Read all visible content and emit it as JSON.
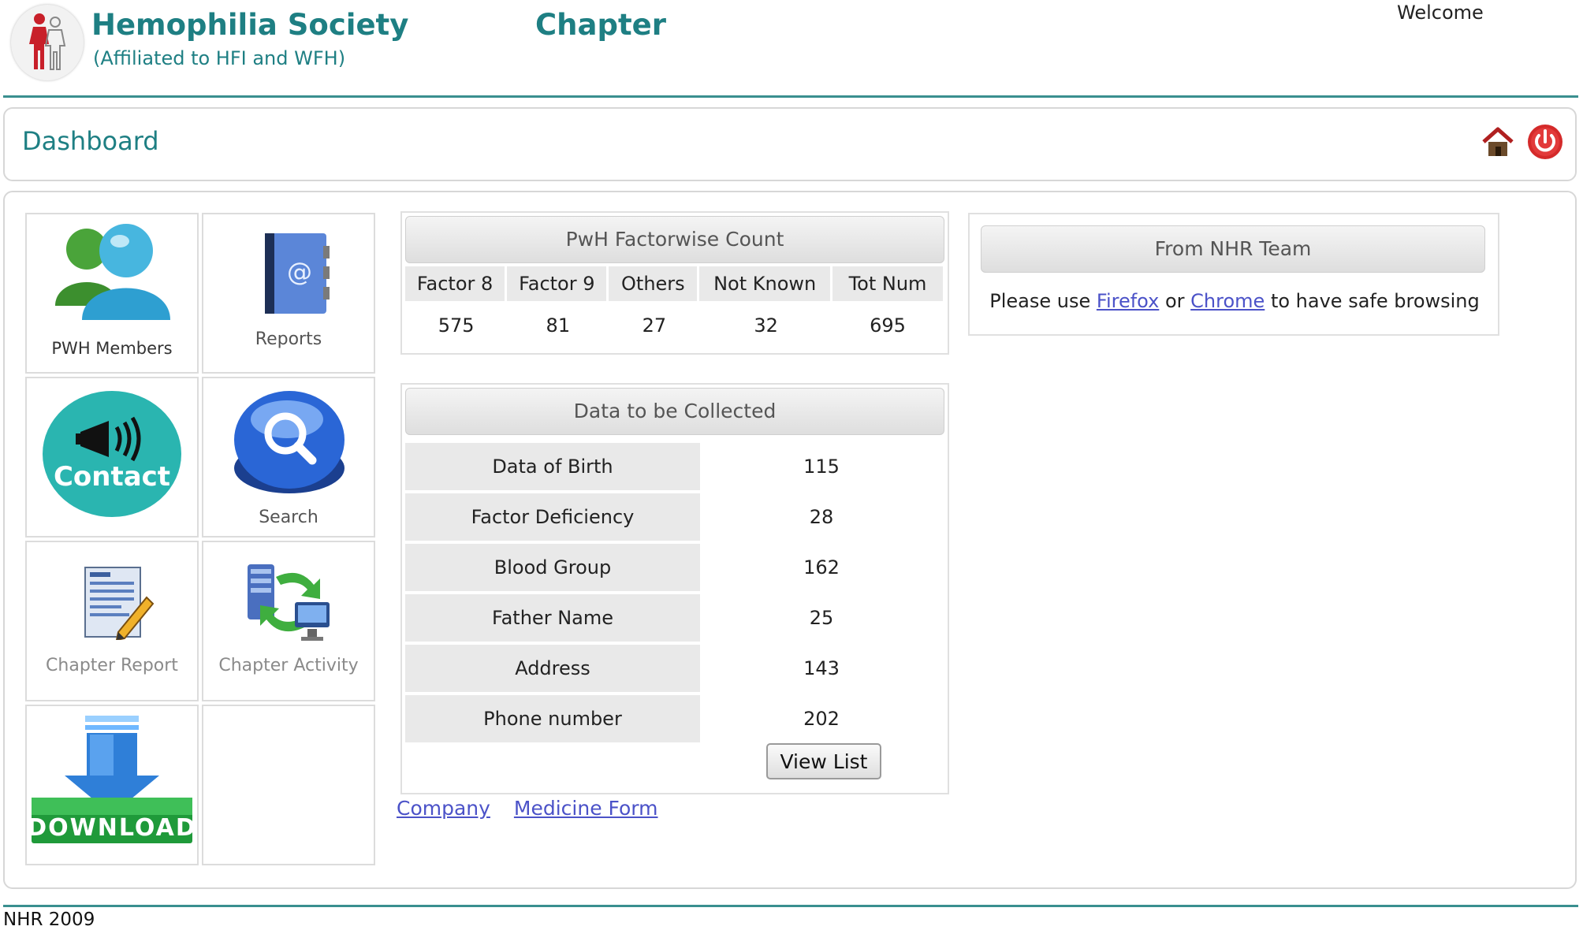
{
  "header": {
    "org_name": "Hemophilia Society",
    "org_subtitle": "(Affiliated to HFI and WFH)",
    "chapter_title": "Chapter",
    "welcome": "Welcome"
  },
  "dashbar": {
    "title": "Dashboard",
    "home_icon": "home-icon",
    "power_icon": "power-icon"
  },
  "tiles": [
    {
      "label": "PWH Members",
      "icon": "members-icon"
    },
    {
      "label": "Reports",
      "icon": "address-book-icon"
    },
    {
      "label": "Contact",
      "icon": "megaphone-icon"
    },
    {
      "label": "Search",
      "icon": "search-icon"
    },
    {
      "label": "Chapter Report",
      "icon": "report-document-icon"
    },
    {
      "label": "Chapter Activity",
      "icon": "activity-sync-icon"
    },
    {
      "label": "DOWNLOAD",
      "icon": "download-arrow-icon"
    }
  ],
  "factorwise": {
    "title": "PwH Factorwise Count",
    "headers": [
      "Factor 8",
      "Factor 9",
      "Others",
      "Not Known",
      "Tot Num"
    ],
    "values": [
      "575",
      "81",
      "27",
      "32",
      "695"
    ]
  },
  "data_collected": {
    "title": "Data to be Collected",
    "rows": [
      {
        "label": "Data of Birth",
        "value": "115"
      },
      {
        "label": "Factor Deficiency",
        "value": "28"
      },
      {
        "label": "Blood Group",
        "value": "162"
      },
      {
        "label": "Father Name",
        "value": "25"
      },
      {
        "label": "Address",
        "value": "143"
      },
      {
        "label": "Phone number",
        "value": "202"
      }
    ],
    "button": "View List"
  },
  "links": {
    "company": "Company",
    "medicine_form": "Medicine Form"
  },
  "nhr_panel": {
    "title": "From NHR Team",
    "text_before": "Please use",
    "firefox": "Firefox",
    "or": "or",
    "chrome": "Chrome",
    "text_after": "to have safe browsing"
  },
  "footer": {
    "text": "NHR 2009"
  },
  "colors": {
    "teal": "#1e7f83",
    "link": "#4b52c8",
    "accent_red": "#d42a2a"
  }
}
